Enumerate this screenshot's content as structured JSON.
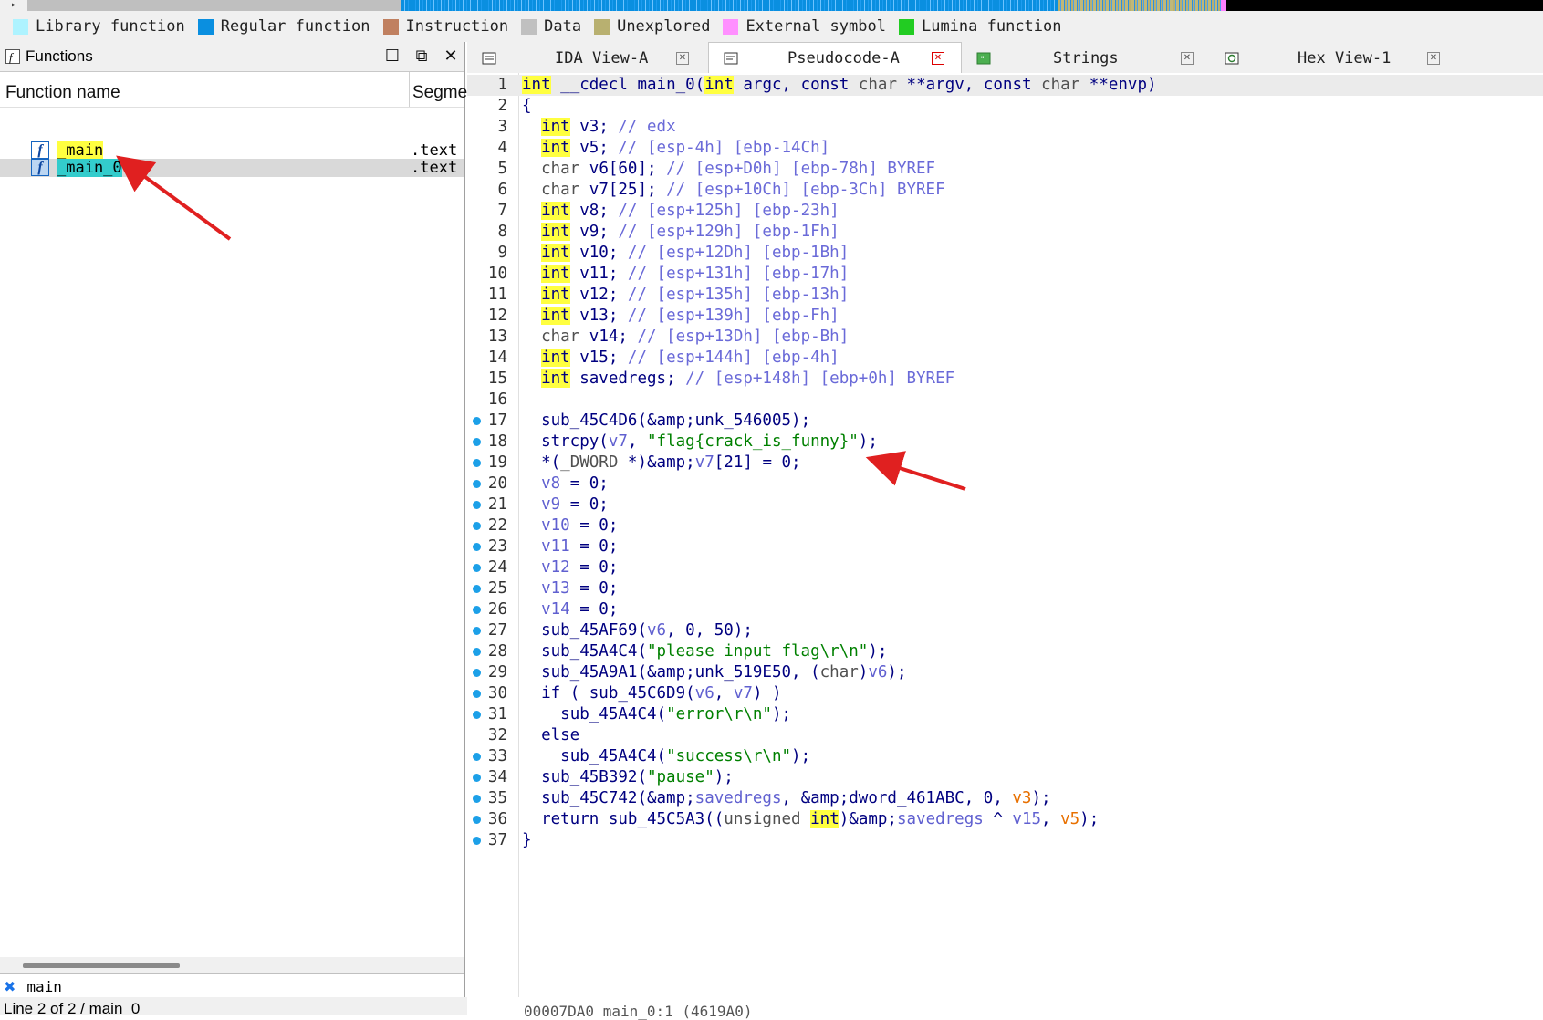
{
  "legend": [
    {
      "label": "Library function",
      "color": "#aef3ff"
    },
    {
      "label": "Regular function",
      "color": "#0a8fe0"
    },
    {
      "label": "Instruction",
      "color": "#c08060"
    },
    {
      "label": "Data",
      "color": "#c0c0c0"
    },
    {
      "label": "Unexplored",
      "color": "#b8b070"
    },
    {
      "label": "External symbol",
      "color": "#ff90ff"
    },
    {
      "label": "Lumina function",
      "color": "#22cc22"
    }
  ],
  "functions_panel": {
    "title": "Functions",
    "col_name": "Function name",
    "col_segment": "Segme",
    "rows": [
      {
        "name": "_main",
        "segment": ".text",
        "highlight": "#ffff40"
      },
      {
        "name": "_main_0",
        "segment": ".text",
        "highlight": "#33cccc"
      }
    ],
    "search_text": "main",
    "status": "Line 2 of 2 / main_0"
  },
  "tabs": [
    {
      "label": "IDA View-A",
      "active": false,
      "icon": "ida-view-icon"
    },
    {
      "label": "Pseudocode-A",
      "active": true,
      "icon": "pseudocode-icon"
    },
    {
      "label": "Strings",
      "active": false,
      "icon": "strings-icon"
    },
    {
      "label": "Hex View-1",
      "active": false,
      "icon": "hex-view-icon"
    }
  ],
  "code": {
    "lines": [
      "int __cdecl main_0(int argc, const char **argv, const char **envp)",
      "{",
      "  int v3; // edx",
      "  int v5; // [esp-4h] [ebp-14Ch]",
      "  char v6[60]; // [esp+D0h] [ebp-78h] BYREF",
      "  char v7[25]; // [esp+10Ch] [ebp-3Ch] BYREF",
      "  int v8; // [esp+125h] [ebp-23h]",
      "  int v9; // [esp+129h] [ebp-1Fh]",
      "  int v10; // [esp+12Dh] [ebp-1Bh]",
      "  int v11; // [esp+131h] [ebp-17h]",
      "  int v12; // [esp+135h] [ebp-13h]",
      "  int v13; // [esp+139h] [ebp-Fh]",
      "  char v14; // [esp+13Dh] [ebp-Bh]",
      "  int v15; // [esp+144h] [ebp-4h]",
      "  int savedregs; // [esp+148h] [ebp+0h] BYREF",
      "",
      "  sub_45C4D6(&unk_546005);",
      "  strcpy(v7, \"flag{crack_is_funny}\");",
      "  *(_DWORD *)&v7[21] = 0;",
      "  v8 = 0;",
      "  v9 = 0;",
      "  v10 = 0;",
      "  v11 = 0;",
      "  v12 = 0;",
      "  v13 = 0;",
      "  v14 = 0;",
      "  sub_45AF69(v6, 0, 50);",
      "  sub_45A4C4(\"please input flag\\r\\n\");",
      "  sub_45A9A1(&unk_519E50, (char)v6);",
      "  if ( sub_45C6D9(v6, v7) )",
      "    sub_45A4C4(\"error\\r\\n\");",
      "  else",
      "    sub_45A4C4(\"success\\r\\n\");",
      "  sub_45B392(\"pause\");",
      "  sub_45C742(&savedregs, &dword_461ABC, 0, v3);",
      "  return sub_45C5A3((unsigned int)&savedregs ^ v15, v5);",
      "}"
    ],
    "breakpoint_lines": [
      17,
      18,
      19,
      20,
      21,
      22,
      23,
      24,
      25,
      26,
      27,
      28,
      29,
      30,
      31,
      33,
      34,
      35,
      36,
      37
    ],
    "status": "00007DA0  main_0:1 (4619A0)"
  }
}
